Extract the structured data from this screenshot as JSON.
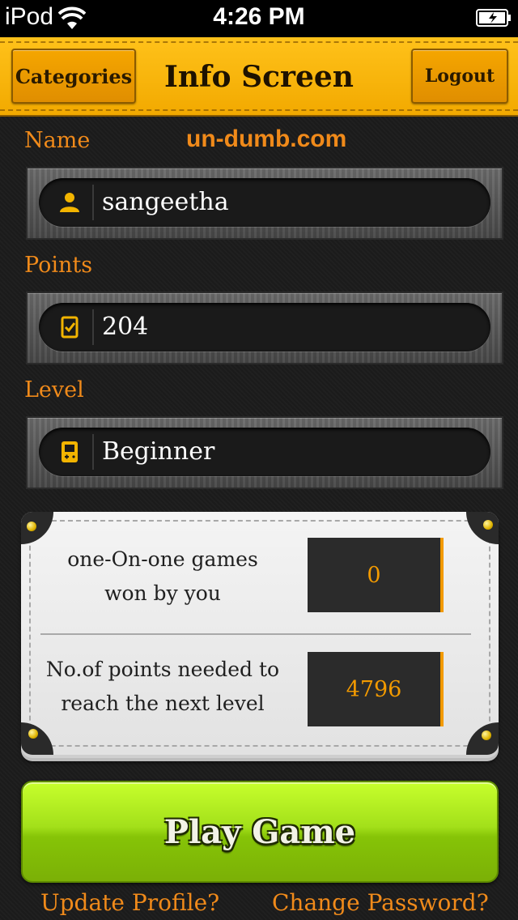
{
  "status_bar": {
    "carrier": "iPod",
    "time": "4:26 PM"
  },
  "nav": {
    "left_button": "Categories",
    "title": "Info Screen",
    "right_button": "Logout"
  },
  "watermark": "un-dumb.com",
  "fields": {
    "name": {
      "label": "Name",
      "value": "sangeetha",
      "icon": "user-icon"
    },
    "points": {
      "label": "Points",
      "value": "204",
      "icon": "checklist-icon"
    },
    "level": {
      "label": "Level",
      "value": "Beginner",
      "icon": "gameboy-icon"
    }
  },
  "stats": {
    "games_won_line1": "one-On-one games",
    "games_won_line2": "won by you",
    "games_won_value": "0",
    "points_needed_line1": "No.of points needed to",
    "points_needed_line2": "reach the next level",
    "points_needed_value": "4796"
  },
  "actions": {
    "play_game": "Play Game",
    "update_profile": "Update Profile?",
    "change_password": "Change Password?"
  },
  "colors": {
    "accent": "#f08a1a",
    "nav_gold": "#f2a900",
    "play_green": "#9fdc1a"
  }
}
